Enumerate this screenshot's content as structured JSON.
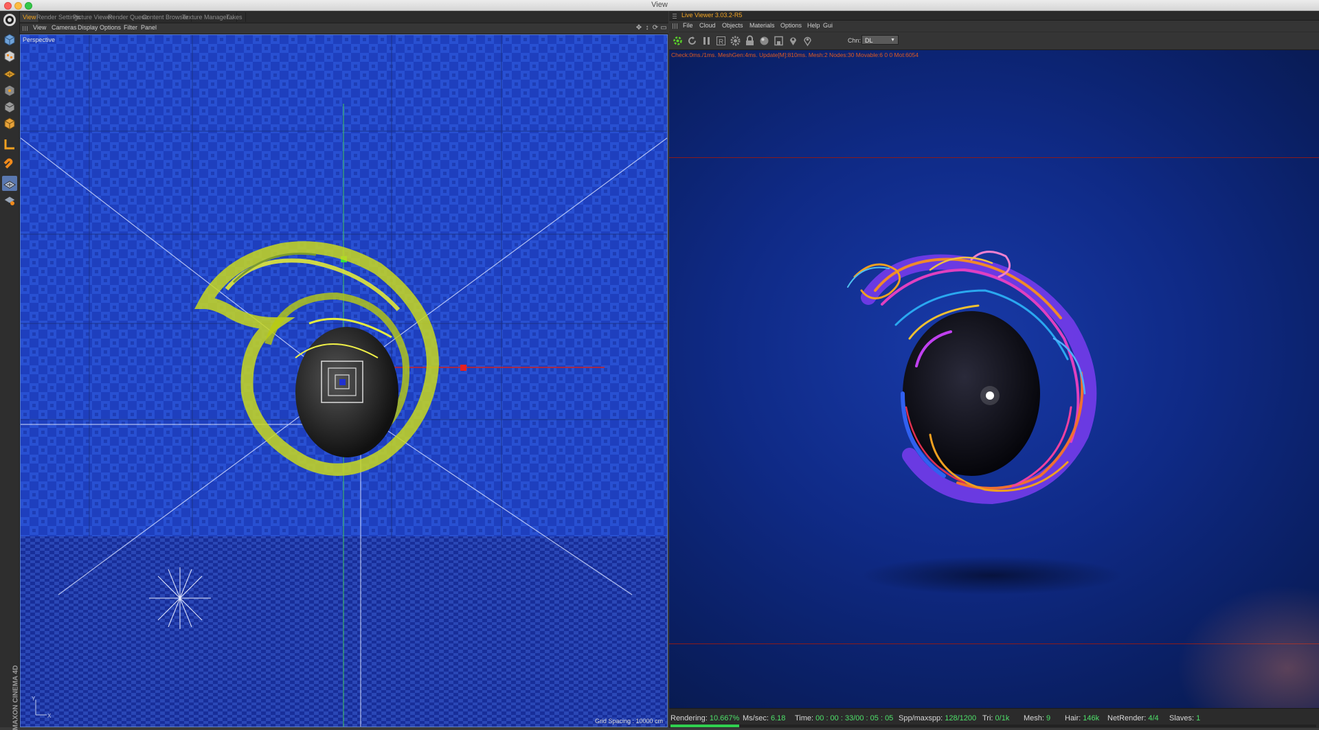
{
  "window": {
    "title": "View"
  },
  "palette": {
    "icons": [
      "cinema4d-logo-icon",
      "cube-mode-icon",
      "texture-mode-icon",
      "plane-mode-icon",
      "model-mode-icon",
      "object-mode-icon",
      "points-mode-icon",
      "axis-mode-icon",
      "magnet-icon",
      "workplane-icon",
      "snap-icon"
    ],
    "brand": "MAXON CINEMA 4D"
  },
  "c4d": {
    "tabs": [
      "View",
      "Render Settings",
      "Picture Viewer",
      "Render Queue",
      "Content Browser",
      "Texture Manager...",
      "Takes"
    ],
    "active_tab": "View",
    "menu": [
      "View",
      "Cameras",
      "Display",
      "Options",
      "Filter",
      "Panel"
    ],
    "viewport_label": "Perspective",
    "grid_spacing": "Grid Spacing : 10000 cm",
    "axis_y": "Y",
    "axis_x": "X"
  },
  "live_viewer": {
    "title": "Live Viewer 3.03.2-R5",
    "menu": [
      "File",
      "Cloud",
      "Objects",
      "Materials",
      "Options",
      "Help",
      "Gui"
    ],
    "channel_label": "Chn:",
    "channel_value": "DL",
    "stats_line": "Check:0ms./1ms. MeshGen:4ms. Update[M]:810ms. Mesh:2 Nodes:30 Movable:6  0 0 Mot:6054",
    "accent_color": "#f5a623",
    "stats_color": "#e05a20",
    "progress": 0.10667
  },
  "status": {
    "rendering_label": "Rendering:",
    "rendering_value": "10.667%",
    "mssec_label": "Ms/sec:",
    "mssec_value": "6.18",
    "time_label": "Time:",
    "time_value": "00 : 00 : 33/00 : 05 : 05",
    "spp_label": "Spp/maxspp:",
    "spp_value": "128/1200",
    "tri_label": "Tri:",
    "tri_value": "0/1k",
    "mesh_label": "Mesh:",
    "mesh_value": "9",
    "hair_label": "Hair:",
    "hair_value": "146k",
    "netrender_label": "NetRender:",
    "netrender_value": "4/4",
    "slaves_label": "Slaves:",
    "slaves_value": "1"
  }
}
